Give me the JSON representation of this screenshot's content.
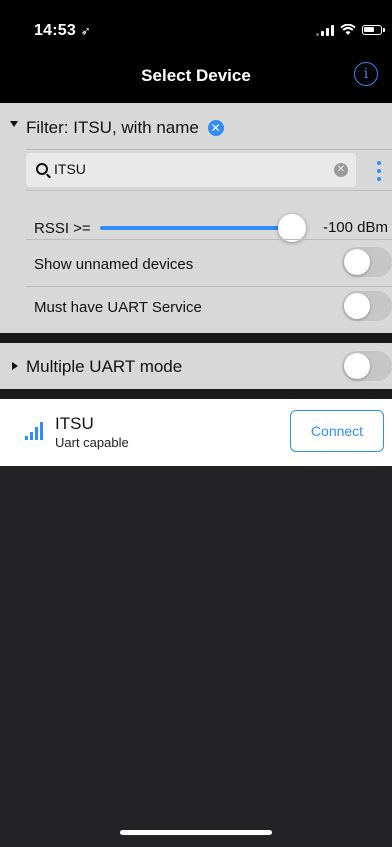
{
  "status_bar": {
    "time": "14:53",
    "location_glyph": "➶"
  },
  "nav": {
    "title": "Select Device",
    "info_glyph": "i"
  },
  "filter": {
    "title": "Filter: ITSU, with name",
    "clear_glyph": "✕",
    "search": {
      "value": "ITSU",
      "placeholder": "",
      "clear_glyph": "✕"
    },
    "rssi": {
      "label": "RSSI >=",
      "value": "-100 dBm",
      "level": 0.9
    },
    "show_unnamed": {
      "label": "Show unnamed devices",
      "on": false
    },
    "must_have_uart": {
      "label": "Must have UART Service",
      "on": false
    }
  },
  "uart_mode": {
    "label": "Multiple UART mode",
    "on": false
  },
  "devices": [
    {
      "name": "ITSU",
      "subtitle": "Uart capable",
      "action_label": "Connect"
    }
  ],
  "colors": {
    "accent": "#2f8df5",
    "panel": "#d8d8d8",
    "background": "#232325"
  },
  "icons": {
    "disclosure_open": "chevron-down-icon",
    "disclosure_closed": "chevron-right-icon",
    "search": "search-icon",
    "more": "more-vertical-icon",
    "signal": "signal-strength-icon",
    "info": "info-icon"
  }
}
